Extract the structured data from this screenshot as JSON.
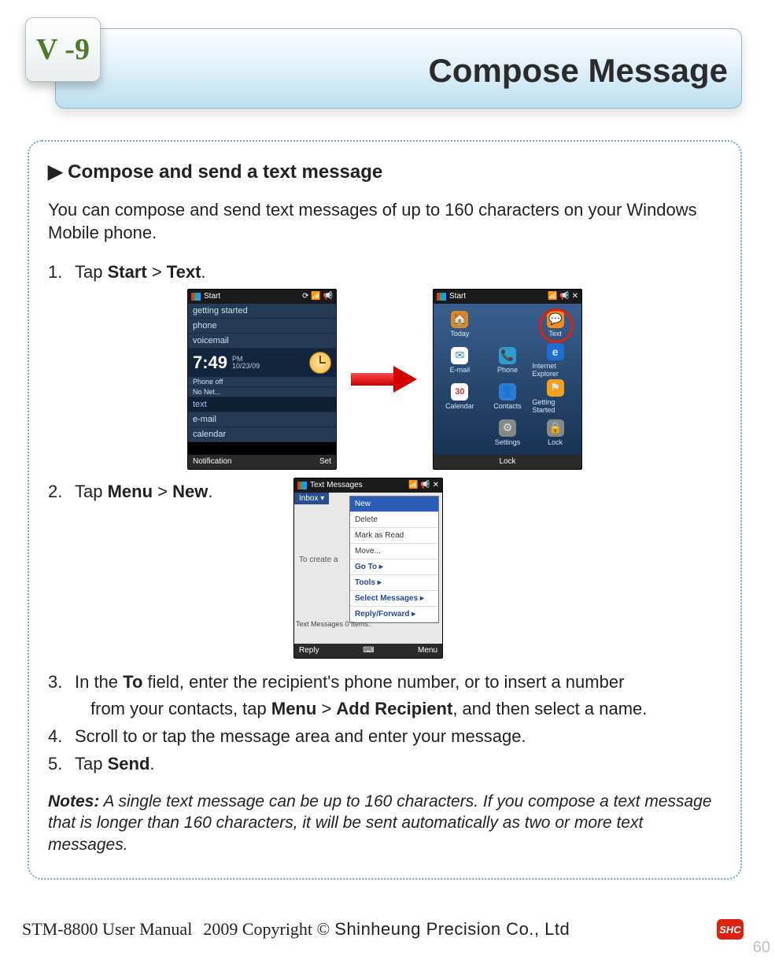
{
  "header": {
    "section_tab": "V -9",
    "title": "Compose Message"
  },
  "content": {
    "subheading": "▶ Compose and send a text message",
    "intro": "You can compose and send text messages of up to 160 characters on your Windows Mobile phone.",
    "step1": {
      "num": "1.",
      "t1": "Tap ",
      "b1": "Start",
      "t2": " > ",
      "b2": "Text",
      "t3": "."
    },
    "step2": {
      "num": "2.",
      "t1": "Tap ",
      "b1": "Menu",
      "t2": " > ",
      "b2": "New",
      "t3": "."
    },
    "step3": {
      "num": "3.",
      "line1_a": "In the ",
      "line1_b": "To",
      "line1_c": " field, enter the recipient's phone number, or to insert a number",
      "line2_a": "from your contacts, tap ",
      "line2_b": "Menu",
      "line2_c": " > ",
      "line2_d": "Add Recipient",
      "line2_e": ", and then select a name."
    },
    "step4": {
      "num": "4.",
      "text": "Scroll to or tap the message area and enter your message."
    },
    "step5": {
      "num": "5.",
      "t1": "Tap ",
      "b1": "Send",
      "t2": "."
    },
    "notes_label": "Notes:",
    "notes_body": " A single text message can be up to 160 characters. If you compose a text message that is longer than 160 characters, it will be sent automatically as two or more text messages."
  },
  "shots": {
    "today": {
      "bar_left": "Start",
      "items": [
        "getting started",
        "phone",
        "voicemail"
      ],
      "time": "7:49",
      "ampm": "PM",
      "date": "10/23/09",
      "phoneoff": "Phone off",
      "nonet": "No Net...",
      "items2": [
        "text",
        "e-mail",
        "calendar"
      ],
      "foot_left": "Notification",
      "foot_right": "Set"
    },
    "grid": {
      "bar_left": "Start",
      "cells": [
        {
          "label": "Today",
          "icon": "🏠",
          "bg": "#d48a2a"
        },
        {
          "label": "",
          "icon": "",
          "bg": "transparent"
        },
        {
          "label": "Text",
          "icon": "💬",
          "bg": "#f28c1a"
        },
        {
          "label": "E-mail",
          "icon": "✉",
          "bg": "#2e7bd1"
        },
        {
          "label": "Phone",
          "icon": "📞",
          "bg": "#2e9bd1"
        },
        {
          "label": "Internet Explorer",
          "icon": "e",
          "bg": "#1e6fd1"
        },
        {
          "label": "Calendar",
          "icon": "30",
          "bg": "#eee"
        },
        {
          "label": "Contacts",
          "icon": "👤",
          "bg": "#2e7bd1"
        },
        {
          "label": "Getting Started",
          "icon": "⚑",
          "bg": "#f0a21e"
        },
        {
          "label": "",
          "icon": "",
          "bg": "transparent"
        },
        {
          "label": "Settings",
          "icon": "⚙",
          "bg": "#888"
        },
        {
          "label": "Lock",
          "icon": "🔒",
          "bg": "#888"
        }
      ],
      "foot_left": "",
      "foot_center": "Lock",
      "foot_right": ""
    },
    "menu": {
      "bar_left": "Text Messages",
      "inbox": "Inbox  ▾",
      "hint": "To create a",
      "items": [
        "New",
        "Delete",
        "Mark as Read",
        "Move...",
        "Go To",
        "Tools",
        "Select Messages",
        "Reply/Forward"
      ],
      "status": "Text Messages  0 Items.",
      "foot_left": "Reply",
      "foot_right": "Menu"
    }
  },
  "footer": {
    "manual": "STM-8800 User Manual",
    "copy": "2009 Copyright ©",
    "company": "Shinheung Precision Co., Ltd",
    "badge": "SHC",
    "page": "60"
  }
}
